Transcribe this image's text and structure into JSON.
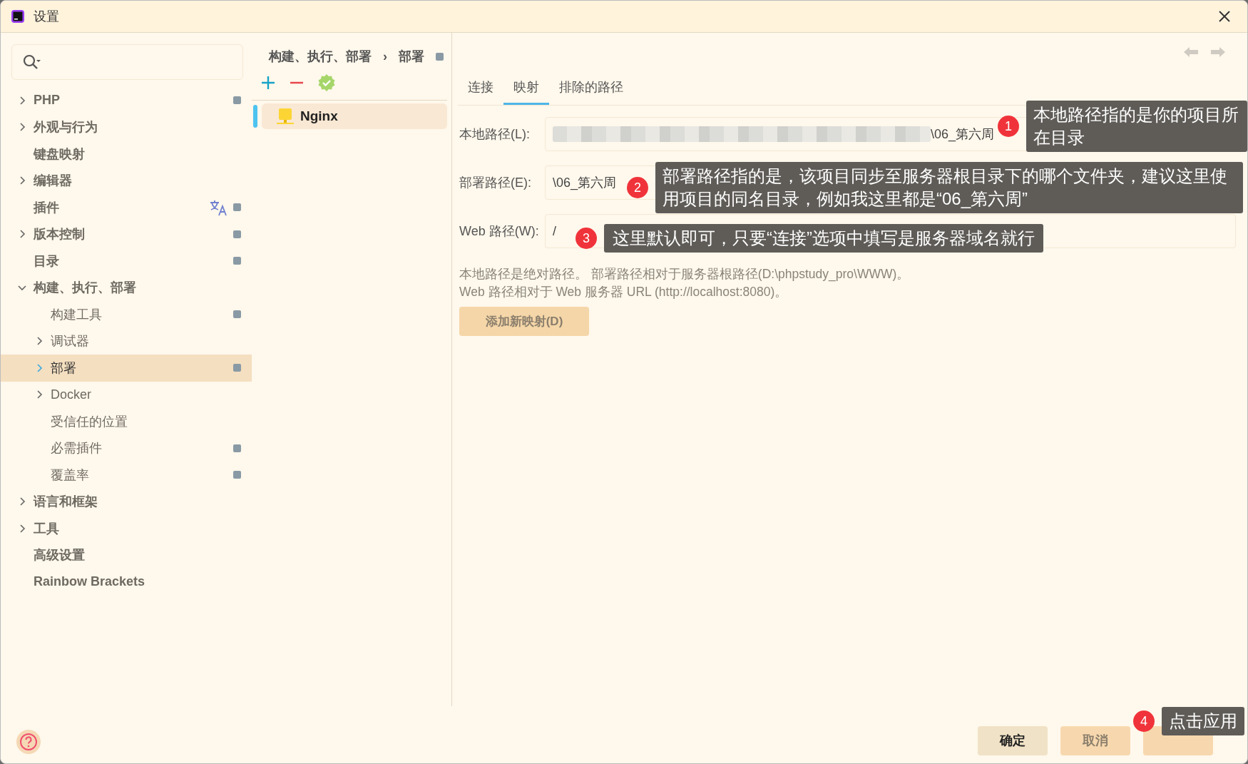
{
  "window": {
    "title": "设置"
  },
  "sidebar": {
    "items": [
      {
        "label": "PHP",
        "expandable": true,
        "expanded": false,
        "selected": false,
        "badge": true
      },
      {
        "label": "外观与行为",
        "expandable": true,
        "expanded": false,
        "selected": false,
        "badge": false
      },
      {
        "label": "键盘映射",
        "expandable": false,
        "selected": false,
        "badge": false
      },
      {
        "label": "编辑器",
        "expandable": true,
        "expanded": false,
        "selected": false,
        "badge": false
      },
      {
        "label": "插件",
        "expandable": false,
        "selected": false,
        "badge": true,
        "translate": true
      },
      {
        "label": "版本控制",
        "expandable": true,
        "expanded": false,
        "selected": false,
        "badge": true
      },
      {
        "label": "目录",
        "expandable": false,
        "selected": false,
        "badge": true
      },
      {
        "label": "构建、执行、部署",
        "expandable": true,
        "expanded": true,
        "selected": false,
        "badge": false,
        "children": [
          {
            "label": "构建工具",
            "expandable": false,
            "selected": false,
            "badge": true
          },
          {
            "label": "调试器",
            "expandable": true,
            "expanded": false,
            "selected": false,
            "badge": false
          },
          {
            "label": "部署",
            "expandable": true,
            "expanded": false,
            "selected": true,
            "badge": true
          },
          {
            "label": "Docker",
            "expandable": true,
            "expanded": false,
            "selected": false,
            "badge": false
          },
          {
            "label": "受信任的位置",
            "expandable": false,
            "selected": false,
            "badge": false
          },
          {
            "label": "必需插件",
            "expandable": false,
            "selected": false,
            "badge": true
          },
          {
            "label": "覆盖率",
            "expandable": false,
            "selected": false,
            "badge": true
          }
        ]
      },
      {
        "label": "语言和框架",
        "expandable": true,
        "expanded": false,
        "selected": false,
        "badge": false
      },
      {
        "label": "工具",
        "expandable": true,
        "expanded": false,
        "selected": false,
        "badge": false
      },
      {
        "label": "高级设置",
        "expandable": false,
        "selected": false,
        "badge": false
      },
      {
        "label": "Rainbow Brackets",
        "expandable": false,
        "selected": false,
        "badge": false
      }
    ]
  },
  "breadcrumb": [
    "构建、执行、部署",
    "›",
    "部署"
  ],
  "servers": [
    {
      "name": "Nginx",
      "selected": true
    }
  ],
  "tabs": [
    {
      "label": "连接",
      "selected": false
    },
    {
      "label": "映射",
      "selected": true
    },
    {
      "label": "排除的路径",
      "selected": false
    }
  ],
  "fields": [
    {
      "label": "本地路径(L):",
      "value": "\\06_第六周",
      "redacted": true
    },
    {
      "label": "部署路径(E):",
      "value": "\\06_第六周",
      "redacted": false
    },
    {
      "label": "Web 路径(W):",
      "value": "/",
      "redacted": false
    }
  ],
  "help_lines": [
    "本地路径是绝对路径。 部署路径相对于服务器根路径(D:\\phpstudy_pro\\WWW)。",
    "Web 路径相对于 Web 服务器 URL (http://localhost:8080)。"
  ],
  "add_mapping_button": "添加新映射(D)",
  "footer_buttons": [
    {
      "label": "确定",
      "kind": "primary"
    },
    {
      "label": "取消",
      "kind": "plain"
    },
    {
      "kind": "covered"
    }
  ],
  "annotations": [
    {
      "number": "1",
      "text": "本地路径指的是你的项目所在目录"
    },
    {
      "number": "2",
      "text": "部署路径指的是，该项目同步至服务器根目录下的哪个文件夹，建议这里使用项目的同名目录，例如我这里都是“06_第六周”"
    },
    {
      "number": "3",
      "text": "这里默认即可，只要“连接”选项中填写是服务器域名就行"
    },
    {
      "number": "4",
      "text": "点击应用"
    }
  ]
}
